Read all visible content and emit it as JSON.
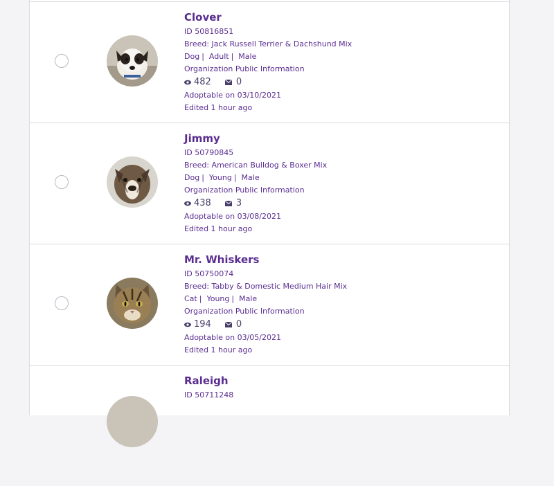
{
  "animals": [
    {
      "name": "Clover",
      "id": "ID 50816851",
      "breed": "Breed: Jack Russell Terrier & Dachshund Mix",
      "species": "Dog",
      "age": "Adult",
      "sex": "Male",
      "org": "Organization Public Information",
      "views": "482",
      "messages": "0",
      "adoptable": "Adoptable on 03/10/2021",
      "edited": "Edited 1 hour ago"
    },
    {
      "name": "Jimmy",
      "id": "ID 50790845",
      "breed": "Breed: American Bulldog & Boxer Mix",
      "species": "Dog",
      "age": "Young",
      "sex": "Male",
      "org": "Organization Public Information",
      "views": "438",
      "messages": "3",
      "adoptable": "Adoptable on 03/08/2021",
      "edited": "Edited 1 hour ago"
    },
    {
      "name": "Mr. Whiskers",
      "id": "ID 50750074",
      "breed": "Breed: Tabby & Domestic Medium Hair Mix",
      "species": "Cat",
      "age": "Young",
      "sex": "Male",
      "org": "Organization Public Information",
      "views": "194",
      "messages": "0",
      "adoptable": "Adoptable on 03/05/2021",
      "edited": "Edited 1 hour ago"
    },
    {
      "name": "Raleigh",
      "id": "ID 50711248"
    }
  ],
  "separator": "|",
  "colors": {
    "accent": "#5a2d91",
    "border": "#d9d9df",
    "background": "#f4f4f6"
  },
  "icons": {
    "views": "eye-icon",
    "messages": "envelope-icon"
  }
}
